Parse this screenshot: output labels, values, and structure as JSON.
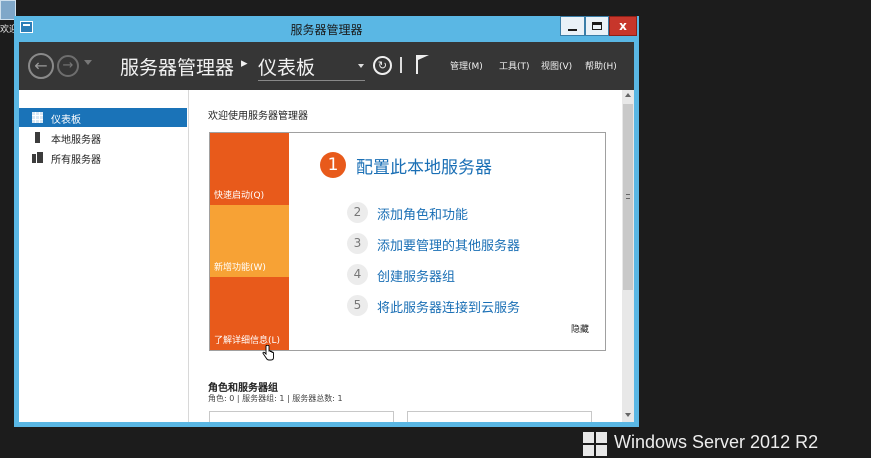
{
  "desktop": {
    "icon_label": "欢迎"
  },
  "window": {
    "title": "服务器管理器",
    "close_label": "x"
  },
  "navbar": {
    "breadcrumb_root": "服务器管理器",
    "breadcrumb_separator": "▸",
    "breadcrumb_current": "仪表板",
    "menus": [
      "管理(M)",
      "工具(T)",
      "视图(V)",
      "帮助(H)"
    ]
  },
  "sidebar": {
    "items": [
      {
        "label": "仪表板",
        "icon": "dashboard-icon",
        "active": true
      },
      {
        "label": "本地服务器",
        "icon": "server-icon",
        "active": false
      },
      {
        "label": "所有服务器",
        "icon": "servers-icon",
        "active": false
      }
    ]
  },
  "main": {
    "welcome_heading": "欢迎使用服务器管理器",
    "tiles": [
      "快速启动(Q)",
      "新增功能(W)",
      "了解详细信息(L)"
    ],
    "primary_step": {
      "number": "1",
      "label": "配置此本地服务器"
    },
    "steps": [
      {
        "number": "2",
        "label": "添加角色和功能"
      },
      {
        "number": "3",
        "label": "添加要管理的其他服务器"
      },
      {
        "number": "4",
        "label": "创建服务器组"
      },
      {
        "number": "5",
        "label": "将此服务器连接到云服务"
      }
    ],
    "hide_label": "隐藏",
    "roles_heading": "角色和服务器组",
    "roles_summary": "角色: 0 | 服务器组: 1 | 服务器总数: 1"
  },
  "branding": {
    "text": "Windows Server 2012 R2"
  },
  "colors": {
    "accent_orange": "#e85a1b",
    "tile_amber": "#f7a235",
    "link_blue": "#1a6fb5",
    "selection_blue": "#1a73b8",
    "title_bar": "#5ab7e4"
  }
}
